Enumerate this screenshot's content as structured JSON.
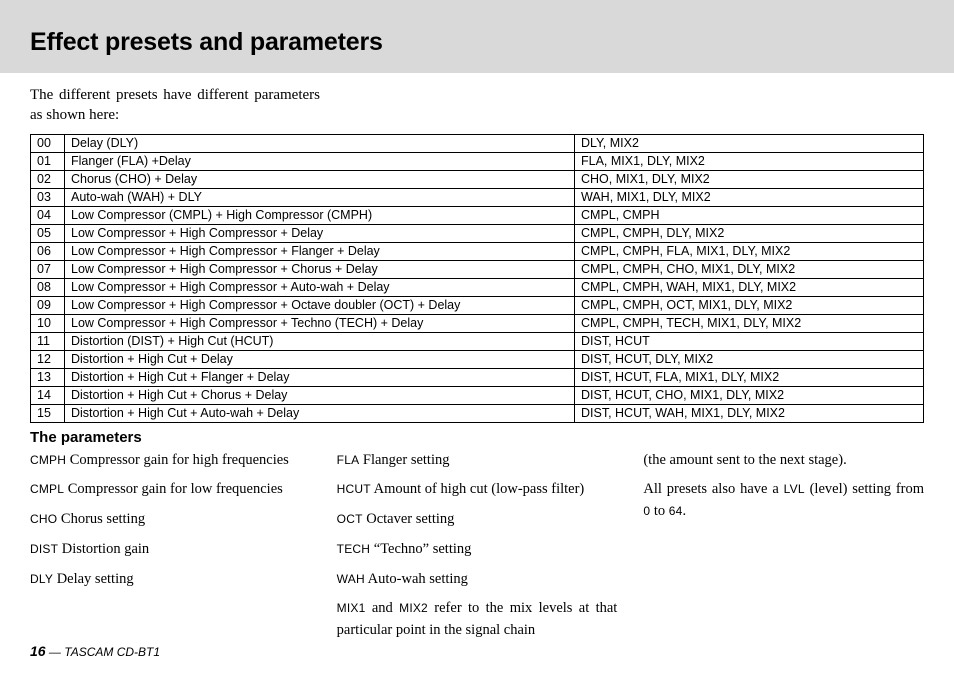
{
  "title": "Effect presets and parameters",
  "intro": "The different presets have different parameters as shown here:",
  "table": {
    "rows": [
      {
        "num": "00",
        "desc": "Delay (DLY)",
        "params": "DLY, MIX2"
      },
      {
        "num": "01",
        "desc": "Flanger (FLA) +Delay",
        "params": "FLA, MIX1, DLY, MIX2"
      },
      {
        "num": "02",
        "desc": "Chorus (CHO) + Delay",
        "params": "CHO, MIX1, DLY, MIX2"
      },
      {
        "num": "03",
        "desc": "Auto-wah (WAH) + DLY",
        "params": "WAH, MIX1, DLY, MIX2"
      },
      {
        "num": "04",
        "desc": "Low Compressor (CMPL) + High Compressor (CMPH)",
        "params": "CMPL, CMPH"
      },
      {
        "num": "05",
        "desc": "Low Compressor + High Compressor + Delay",
        "params": "CMPL, CMPH, DLY, MIX2"
      },
      {
        "num": "06",
        "desc": "Low Compressor + High Compressor + Flanger + Delay",
        "params": "CMPL, CMPH, FLA, MIX1, DLY, MIX2"
      },
      {
        "num": "07",
        "desc": "Low Compressor + High Compressor + Chorus + Delay",
        "params": "CMPL, CMPH, CHO, MIX1, DLY, MIX2"
      },
      {
        "num": "08",
        "desc": "Low Compressor + High Compressor + Auto-wah + Delay",
        "params": "CMPL, CMPH, WAH, MIX1, DLY, MIX2"
      },
      {
        "num": "09",
        "desc": "Low Compressor + High Compressor + Octave doubler (OCT) + Delay",
        "params": "CMPL, CMPH, OCT, MIX1, DLY, MIX2"
      },
      {
        "num": "10",
        "desc": "Low Compressor + High Compressor +  Techno  (TECH) + Delay",
        "params": "CMPL, CMPH, TECH, MIX1, DLY, MIX2"
      },
      {
        "num": "11",
        "desc": "Distortion (DIST) + High Cut (HCUT)",
        "params": "DIST, HCUT"
      },
      {
        "num": "12",
        "desc": "Distortion + High Cut + Delay",
        "params": "DIST, HCUT, DLY, MIX2"
      },
      {
        "num": "13",
        "desc": "Distortion + High Cut + Flanger + Delay",
        "params": "DIST, HCUT, FLA, MIX1, DLY, MIX2"
      },
      {
        "num": "14",
        "desc": "Distortion + High Cut + Chorus + Delay",
        "params": "DIST, HCUT, CHO, MIX1, DLY, MIX2"
      },
      {
        "num": "15",
        "desc": "Distortion + High Cut + Auto-wah + Delay",
        "params": "DIST, HCUT, WAH, MIX1, DLY, MIX2"
      }
    ]
  },
  "subtitle": "The parameters",
  "defs": {
    "cmph_abbr": "CMPH",
    "cmph_txt": " Compressor gain for high frequencies",
    "cmpl_abbr": "CMPL",
    "cmpl_txt": " Compressor gain for low frequencies",
    "cho_abbr": "CHO",
    "cho_txt": " Chorus setting",
    "dist_abbr": "DIST",
    "dist_txt": " Distortion gain",
    "dly_abbr": "DLY",
    "dly_txt": " Delay setting",
    "fla_abbr": "FLA",
    "fla_txt": " Flanger setting",
    "hcut_abbr": "HCUT",
    "hcut_txt": " Amount of high cut (low-pass filter)",
    "oct_abbr": "OCT",
    "oct_txt": " Octaver setting",
    "tech_abbr": "TECH",
    "tech_txt": " “Techno” setting",
    "wah_abbr": "WAH",
    "wah_txt": " Auto-wah setting",
    "mix1_abbr": "MIX1",
    "and_txt": " and ",
    "mix2_abbr": "MIX2",
    "mix_txt": " refer to the mix levels at that particular point in the signal chain ",
    "mix_txt2": "(the amount sent to the next stage).",
    "lvl_pre": "All presets also have a ",
    "lvl_abbr": "LVL",
    "lvl_post": " (level) setting from ",
    "zero": "0",
    "to_txt": " to ",
    "sixtyfour": "64",
    "dot": "."
  },
  "footer": {
    "page": "16",
    "sep": " — ",
    "product": "TASCAM CD-BT1"
  }
}
